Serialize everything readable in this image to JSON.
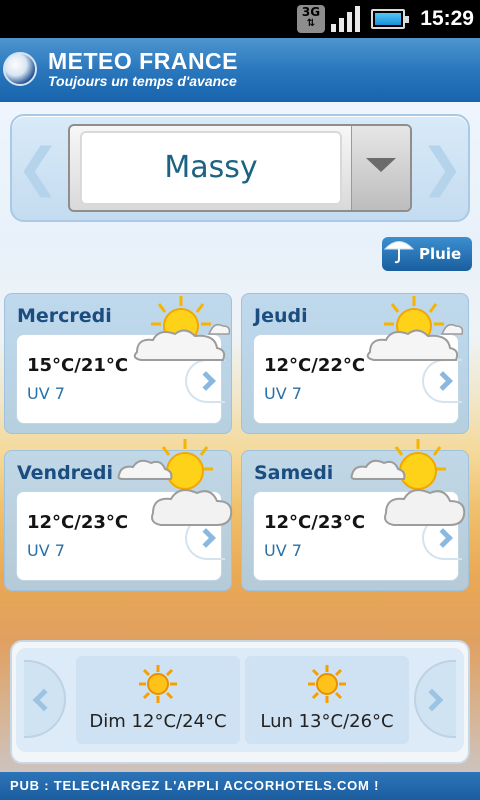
{
  "status_bar": {
    "network": "3G",
    "time": "15:29",
    "icons": [
      "network-3g-icon",
      "signal-icon",
      "battery-icon"
    ]
  },
  "header": {
    "brand": "METEO FRANCE",
    "tagline": "Toujours un temps d'avance",
    "logo": "meteo-france-logo"
  },
  "city": {
    "name": "Massy",
    "prev_icon": "chevron-left-icon",
    "next_icon": "chevron-right-icon",
    "dropdown_icon": "caret-down-icon"
  },
  "rain_button": {
    "label": "Pluie",
    "icon": "umbrella-icon"
  },
  "forecast": [
    {
      "day": "Mercredi",
      "temps": "15°C/21°C",
      "uv": "UV 7",
      "weather_icon": "partly-sunny-icon"
    },
    {
      "day": "Jeudi",
      "temps": "12°C/22°C",
      "uv": "UV 7",
      "weather_icon": "partly-sunny-icon"
    },
    {
      "day": "Vendredi",
      "temps": "12°C/23°C",
      "uv": "UV 7",
      "weather_icon": "sun-clouds-icon"
    },
    {
      "day": "Samedi",
      "temps": "12°C/23°C",
      "uv": "UV 7",
      "weather_icon": "sun-clouds-icon"
    }
  ],
  "later": [
    {
      "label": "Dim 12°C/24°C",
      "weather_icon": "sun-icon"
    },
    {
      "label": "Lun 13°C/26°C",
      "weather_icon": "sun-icon"
    }
  ],
  "ad": {
    "text": "PUB : TELECHARGEZ  L'APPLI  ACCORHOTELS.COM !"
  },
  "colors": {
    "header_blue": "#2a77bd",
    "day_title": "#1c4d80",
    "uv_text": "#2870a8",
    "city_text": "#1b6382"
  }
}
